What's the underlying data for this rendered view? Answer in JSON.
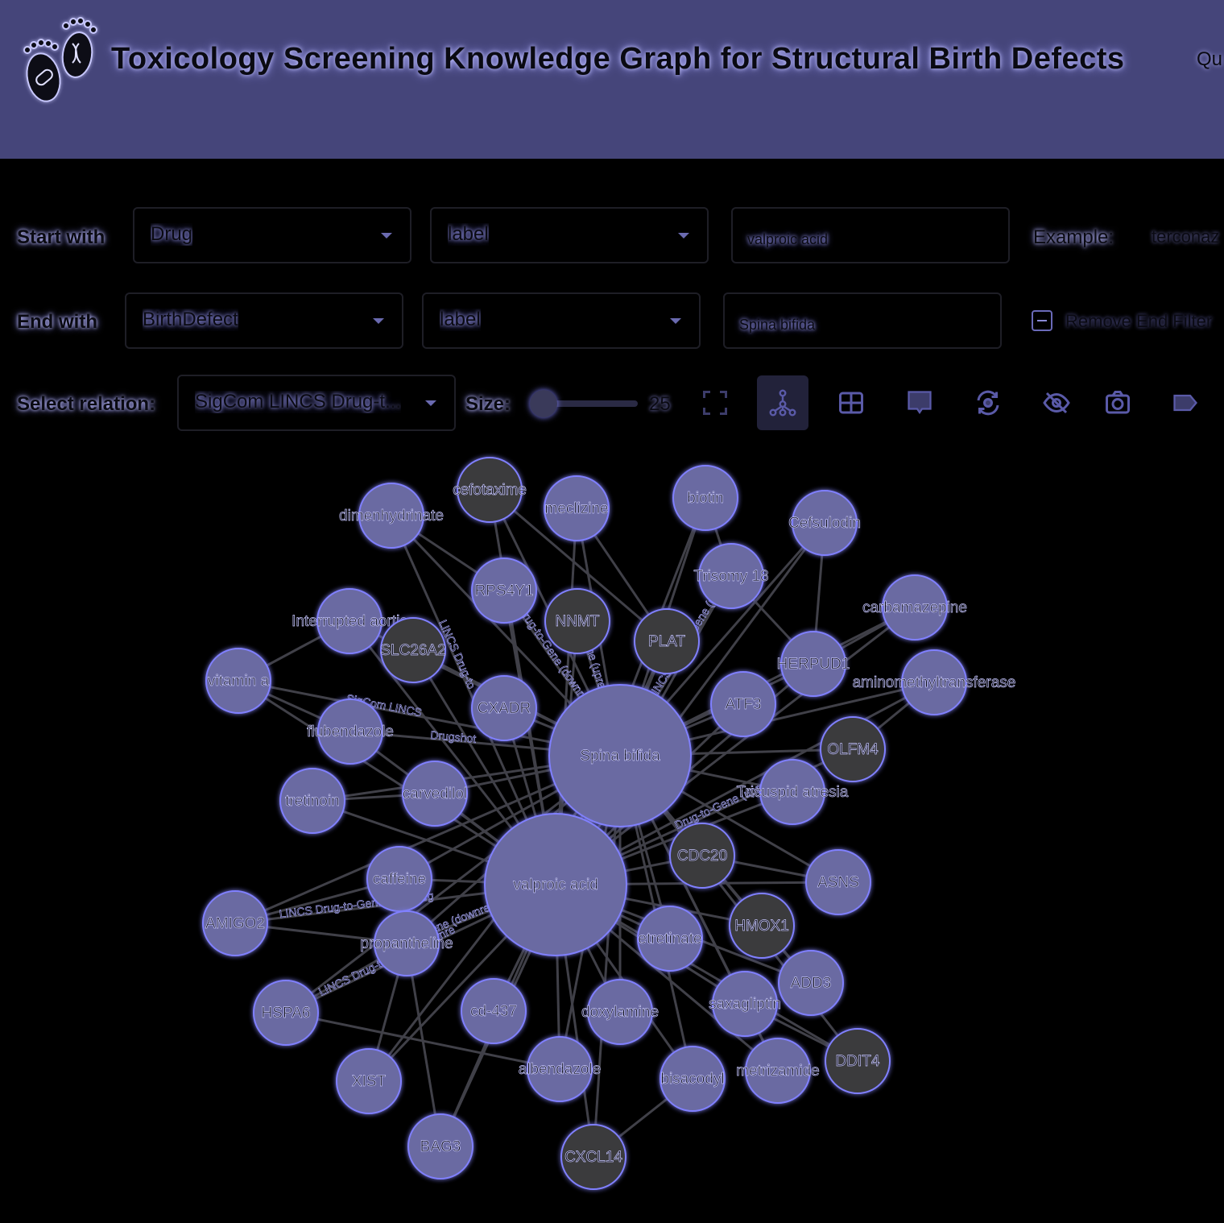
{
  "header": {
    "title": "Toxicology Screening Knowledge Graph for Structural Birth Defects",
    "nav_link": "Qu"
  },
  "query": {
    "start_label": "Start with",
    "start_type": "Drug",
    "start_field": "label",
    "start_value": "valproic acid",
    "example_label": "Example:",
    "example_value": "terconaz",
    "end_label": "End with",
    "end_type": "BirthDefect",
    "end_field": "label",
    "end_value": "Spina bifida",
    "remove_end_filter": "Remove End Filter",
    "relation_label": "Select relation:",
    "relation_value": "SigCom LINCS Drug-t...",
    "size_label": "Size:",
    "size_value": 25
  },
  "toolbar": {
    "icons": [
      "fit-screen-icon",
      "network-layout-icon",
      "grid-layout-icon",
      "tooltip-icon",
      "refresh-layout-icon",
      "hide-labels-icon",
      "camera-icon",
      "label-tag-icon"
    ]
  },
  "colors": {
    "header_bg": "#45457a",
    "node_fill": "#6a6aa2",
    "node_gene_fill": "#3a3a3c",
    "node_glow": "#8080ff",
    "edge": "#404048"
  },
  "graph": {
    "nodes": [
      {
        "label": "Spina bifida",
        "type": "defect",
        "big": true
      },
      {
        "label": "valproic acid",
        "type": "drug",
        "big": true
      },
      {
        "label": "cefotaxime",
        "type": "gene"
      },
      {
        "label": "dimenhydrinate",
        "type": "drug"
      },
      {
        "label": "meclizine",
        "type": "drug"
      },
      {
        "label": "biotin",
        "type": "drug"
      },
      {
        "label": "Cefsulodin",
        "type": "drug"
      },
      {
        "label": "Trisomy 18",
        "type": "defect"
      },
      {
        "label": "RPS4Y1",
        "type": "drug"
      },
      {
        "label": "NNMT",
        "type": "gene"
      },
      {
        "label": "PLAT",
        "type": "gene"
      },
      {
        "label": "carbamazepine",
        "type": "drug"
      },
      {
        "label": "Interrupted aortic",
        "type": "defect"
      },
      {
        "label": "SLC26A2",
        "type": "gene"
      },
      {
        "label": "HERPUD1",
        "type": "drug"
      },
      {
        "label": "aminomethyltransferase",
        "type": "drug"
      },
      {
        "label": "vitamin a",
        "type": "drug"
      },
      {
        "label": "CXADR",
        "type": "drug"
      },
      {
        "label": "ATF3",
        "type": "drug"
      },
      {
        "label": "flubendazole",
        "type": "drug"
      },
      {
        "label": "OLFM4",
        "type": "gene"
      },
      {
        "label": "tretinoin",
        "type": "drug"
      },
      {
        "label": "carvedilol",
        "type": "drug"
      },
      {
        "label": "Tricuspid atresia",
        "type": "defect"
      },
      {
        "label": "CDC20",
        "type": "gene"
      },
      {
        "label": "caffeine",
        "type": "drug"
      },
      {
        "label": "ASNS",
        "type": "drug"
      },
      {
        "label": "AMIGO2",
        "type": "drug"
      },
      {
        "label": "HMOX1",
        "type": "gene"
      },
      {
        "label": "propantheline",
        "type": "drug"
      },
      {
        "label": "etretinate",
        "type": "drug"
      },
      {
        "label": "ADD3",
        "type": "drug"
      },
      {
        "label": "HSPA6",
        "type": "drug"
      },
      {
        "label": "cd-437",
        "type": "drug"
      },
      {
        "label": "doxylamine",
        "type": "drug"
      },
      {
        "label": "saxagliptin",
        "type": "drug"
      },
      {
        "label": "XIST",
        "type": "drug"
      },
      {
        "label": "albendazole",
        "type": "drug"
      },
      {
        "label": "bisacodyl",
        "type": "drug"
      },
      {
        "label": "metrizamide",
        "type": "drug"
      },
      {
        "label": "DDIT4",
        "type": "gene"
      },
      {
        "label": "BAG3",
        "type": "drug"
      },
      {
        "label": "CXCL14",
        "type": "gene"
      }
    ],
    "edge_labels": [
      "LINCS Drug-to",
      "Drug-to-Gene (downr",
      "SigCom LINCS",
      "Drugshot",
      "Gene (upregula",
      "SigCom LINCS Drug-to-Gene (upregulates)",
      "LINCS Drug-to-Gene (downreg",
      "Gene (downregu",
      "LINCS Drug-to-Gene (downre",
      "Drug-to-Gene (upregulates)"
    ]
  }
}
